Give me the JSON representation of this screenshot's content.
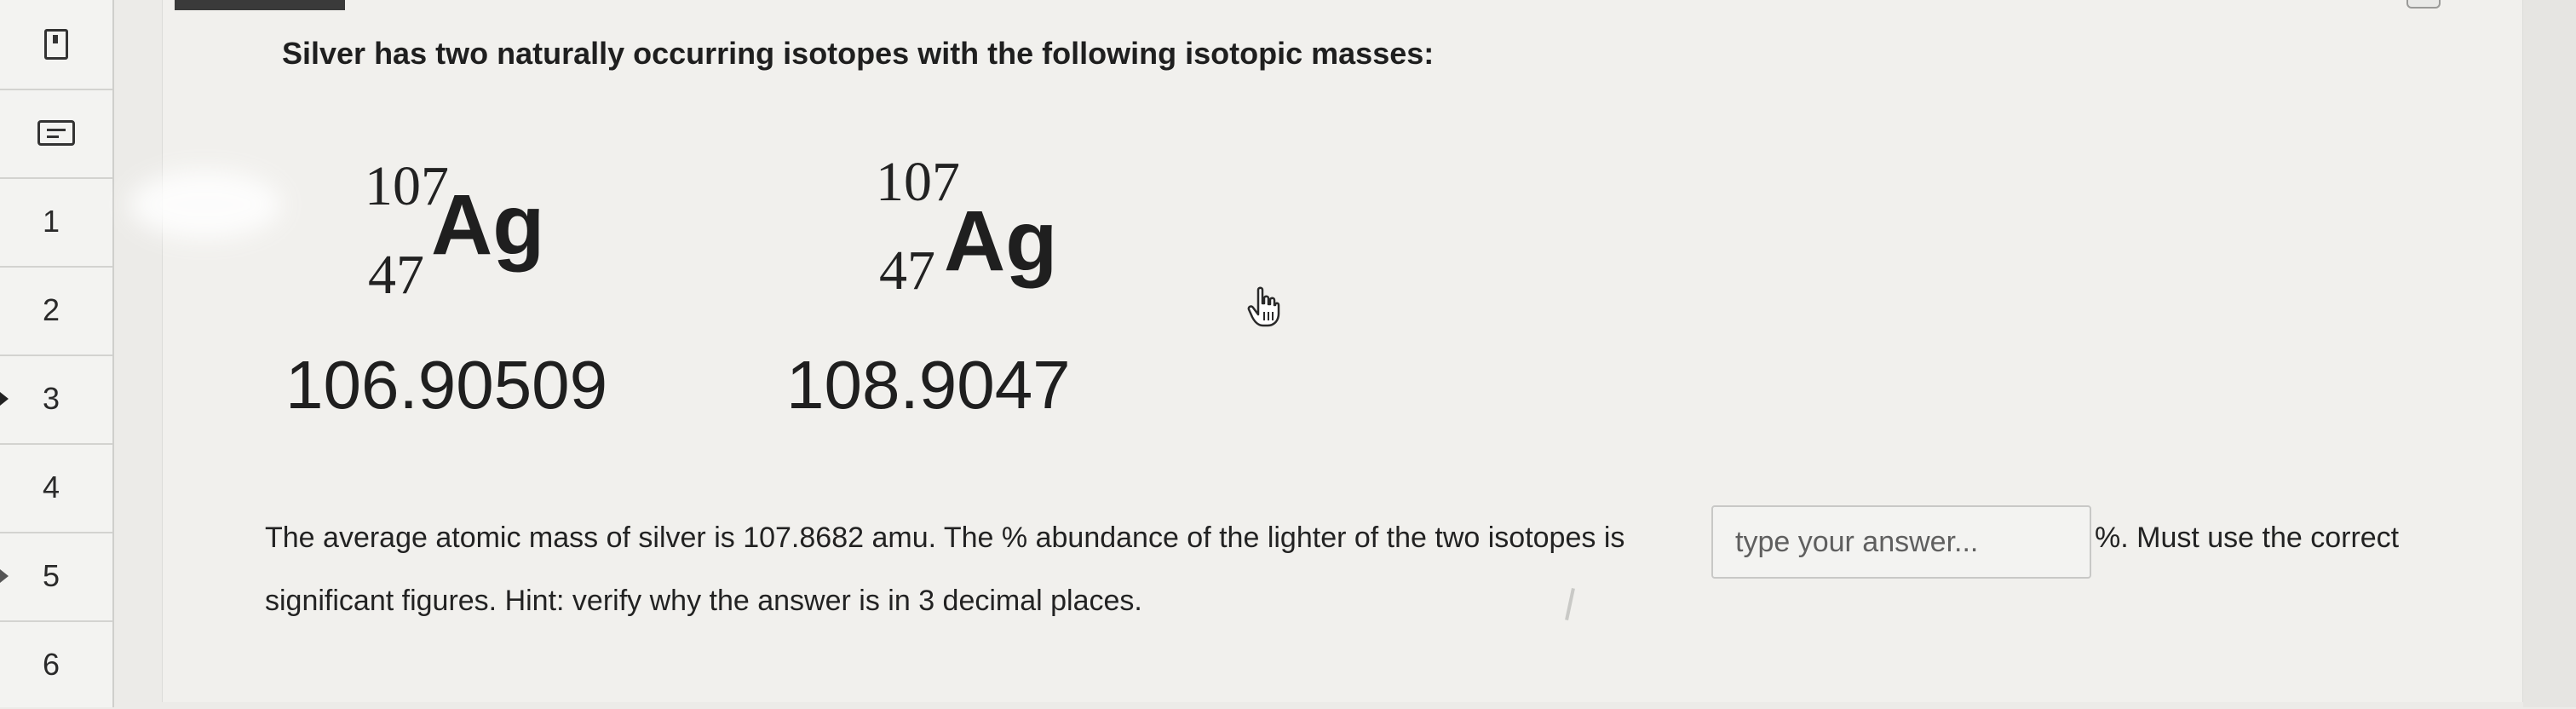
{
  "sidebar": {
    "items": [
      {
        "label": ""
      },
      {
        "label": ""
      },
      {
        "label": "1"
      },
      {
        "label": "2"
      },
      {
        "label": "3"
      },
      {
        "label": "4"
      },
      {
        "label": "5"
      },
      {
        "label": "6"
      }
    ]
  },
  "question": {
    "title": "Silver has two naturally occurring isotopes with the following isotopic masses:",
    "isotopes": [
      {
        "mass_number": "107",
        "atomic_number": "47",
        "symbol": "Ag",
        "isotopic_mass": "106.90509"
      },
      {
        "mass_number": "107",
        "atomic_number": "47",
        "symbol": "Ag",
        "isotopic_mass": "108.9047"
      }
    ],
    "prompt_text": "The average atomic mass of silver is 107.8682 amu. The % abundance of the lighter of the two isotopes is",
    "answer_placeholder": "type your answer...",
    "answer_value": "",
    "suffix_text": "%. Must use the correct",
    "prompt_continuation": "significant figures. Hint: verify why the answer is in 3 decimal places."
  }
}
